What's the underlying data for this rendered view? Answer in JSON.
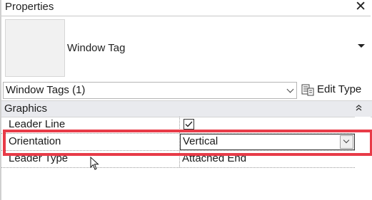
{
  "panel": {
    "title": "Properties",
    "close_glyph": "✕"
  },
  "type_selector": {
    "type_name": "Window Tag"
  },
  "filter": {
    "selected": "Window Tags (1)",
    "edit_type_label": "Edit Type"
  },
  "section": {
    "label": "Graphics",
    "collapse_glyph": "˄\n˄"
  },
  "params": [
    {
      "name": "Leader Line",
      "value": "",
      "checked": true
    },
    {
      "name": "Orientation",
      "value": "Vertical"
    },
    {
      "name": "Leader Type",
      "value": "Attached End"
    }
  ],
  "colors": {
    "highlight": "#e83b48",
    "section_bg": "#e9eaee"
  }
}
